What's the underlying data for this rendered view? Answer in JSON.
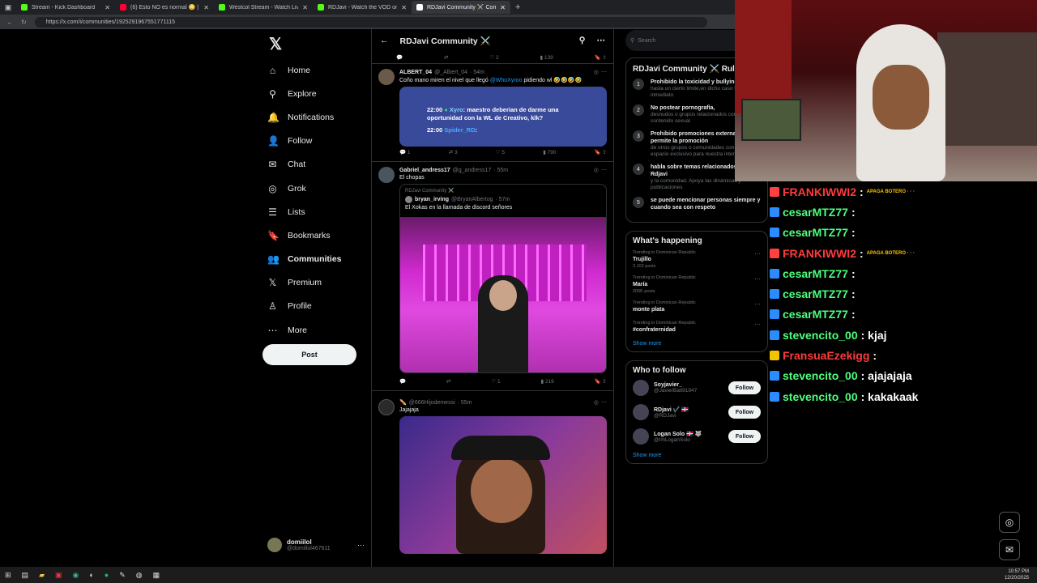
{
  "tabs": [
    {
      "label": "Stream - Kick Dashboard",
      "color": "#53fc18",
      "active": false
    },
    {
      "label": "(6) Esto NO es normal 😳 | La Kick",
      "color": "#ff0033",
      "active": false
    },
    {
      "label": "Westcol Stream - Watch Live on Kick",
      "color": "#53fc18",
      "active": false
    },
    {
      "label": "RDJavi - Watch the VOD on Kick",
      "color": "#53fc18",
      "active": false
    },
    {
      "label": "RDJavi Community ⚔️ Community",
      "color": "#ffffff",
      "active": true
    }
  ],
  "address": {
    "url": "https://x.com/i/communities/1925291967551771115"
  },
  "nav": {
    "logo": "𝕏",
    "items": [
      {
        "icon": "⌂",
        "label": "Home",
        "bold": false
      },
      {
        "icon": "⚲",
        "label": "Explore",
        "bold": false
      },
      {
        "icon": "🔔",
        "label": "Notifications",
        "bold": false
      },
      {
        "icon": "👤",
        "label": "Follow",
        "bold": false
      },
      {
        "icon": "✉",
        "label": "Chat",
        "bold": false
      },
      {
        "icon": "◎",
        "label": "Grok",
        "bold": false
      },
      {
        "icon": "☰",
        "label": "Lists",
        "bold": false
      },
      {
        "icon": "🔖",
        "label": "Bookmarks",
        "bold": false
      },
      {
        "icon": "👥",
        "label": "Communities",
        "bold": true
      },
      {
        "icon": "𝕏",
        "label": "Premium",
        "bold": false
      },
      {
        "icon": "♙",
        "label": "Profile",
        "bold": false
      },
      {
        "icon": "⋯",
        "label": "More",
        "bold": false
      }
    ],
    "post": "Post"
  },
  "account": {
    "name": "domiilol",
    "handle": "@domiilol467611"
  },
  "feed": {
    "title": "RDJavi Community ⚔️",
    "top_actions": {
      "replies": "",
      "retweets": "",
      "likes": "2",
      "views": "139"
    },
    "tweets": [
      {
        "name": "ALBERT_04",
        "handle": "@_Albert_04",
        "time": "· 54m",
        "text": "Coño mano miren el nivel que llegó",
        "mention": "@WhoXyroo",
        "text2": "pidiendo wl 🤣🤣🤣🤣",
        "chat_lines": [
          {
            "time": "22:00",
            "user": "Xyro",
            "msg": "maestro deberian de darme una oportunidad con la WL de Creativo, klk?"
          },
          {
            "time": "22:00",
            "user": "Spider_RD",
            "msg": ""
          }
        ],
        "replies": "1",
        "retweets": "3",
        "likes": "5",
        "views": "790"
      },
      {
        "name": "Gabriel_andress17",
        "handle": "@g_andress17",
        "time": "· 55m",
        "text": "El chopas",
        "quote_community": "RDJavi Community ⚔️",
        "quote_name": "bryan_irving",
        "quote_handle": "@BryanAlbertog",
        "quote_time": "· 57m",
        "quote_text": "El Xokas en la llamada de discord señores",
        "replies": "",
        "retweets": "",
        "likes": "1",
        "views": "219"
      },
      {
        "name": "✏️",
        "handle": "@666Hijodemessi",
        "time": "· 55m",
        "text": "Jajajaja"
      }
    ]
  },
  "right": {
    "search_placeholder": "Search",
    "rules_title": "RDJavi Community ⚔️ Rules",
    "rules": [
      {
        "n": "1",
        "title": "Prohibido la toxicidad y bullying",
        "desc": "hasta un cierto limite,en dicho caso bloqueo inmediato"
      },
      {
        "n": "2",
        "title": "No postear pornografía,",
        "desc": "desnudos o grupos relacionados con contenido sexual"
      },
      {
        "n": "3",
        "title": "Prohibido promociones externas, permite la promoción",
        "desc": "de otros grupos o comunidades con un espacio exclusivo para nuestra interacción"
      },
      {
        "n": "4",
        "title": "habla sobre temas relacionados con Rdjavi",
        "desc": "y la comunidad. Apoya las dinámicas y publicaciones"
      },
      {
        "n": "5",
        "title": "se puede mencionar personas siempre y cuando sea con respeto",
        "desc": ""
      }
    ],
    "happening_title": "What's happening",
    "trends": [
      {
        "meta": "Trending in Dominican Republic",
        "name": "Trujillo",
        "posts": "2,102 posts"
      },
      {
        "meta": "Trending in Dominican Republic",
        "name": "María",
        "posts": "206K posts"
      },
      {
        "meta": "Trending in Dominican Republic",
        "name": "monte plata",
        "posts": ""
      },
      {
        "meta": "Trending in Dominican Republic",
        "name": "#confraternidad",
        "posts": ""
      }
    ],
    "show_more": "Show more",
    "wtf_title": "Who to follow",
    "wtf": [
      {
        "name": "Soyjavier_",
        "handle": "@JavierBati91947",
        "btn": "Follow"
      },
      {
        "name": "RDjavi ✔️ 🇩🇴",
        "handle": "@RDJavi",
        "btn": "Follow"
      },
      {
        "name": "Logan Solo 🇩🇴 🐺",
        "handle": "@ImLoganSolo",
        "btn": "Follow"
      }
    ],
    "show_more2": "Show more"
  },
  "chat": [
    {
      "user": "FRANKIWWI2",
      "text": ":",
      "color": "#ff3b3b",
      "badge": "#ff4040",
      "emotes": "APAGA BOTERO · · ·"
    },
    {
      "user": "cesarMTZ77",
      "text": ":",
      "color": "#4dff7c",
      "badge": "#2a8cff",
      "emotes": ""
    },
    {
      "user": "cesarMTZ77",
      "text": ":",
      "color": "#4dff7c",
      "badge": "#2a8cff",
      "emotes": ""
    },
    {
      "user": "FRANKIWWI2",
      "text": ":",
      "color": "#ff3b3b",
      "badge": "#ff4040",
      "emotes": "APAGA BOTERO · · ·"
    },
    {
      "user": "cesarMTZ77",
      "text": ":",
      "color": "#4dff7c",
      "badge": "#2a8cff",
      "emotes": ""
    },
    {
      "user": "cesarMTZ77",
      "text": ":",
      "color": "#4dff7c",
      "badge": "#2a8cff",
      "emotes": ""
    },
    {
      "user": "cesarMTZ77",
      "text": ":",
      "color": "#4dff7c",
      "badge": "#2a8cff",
      "emotes": ""
    },
    {
      "user": "stevencito_00",
      "text": ": kjaj",
      "color": "#4dff7c",
      "badge": "#2a8cff",
      "emotes": ""
    },
    {
      "user": "FransuaEzekigg",
      "text": ":",
      "color": "#ff3b3b",
      "badge": "#f5c400",
      "emotes": ""
    },
    {
      "user": "stevencito_00",
      "text": ": ajajajaja",
      "color": "#4dff7c",
      "badge": "#2a8cff",
      "emotes": ""
    },
    {
      "user": "stevencito_00",
      "text": ": kakakaak",
      "color": "#4dff7c",
      "badge": "#2a8cff",
      "emotes": ""
    }
  ],
  "clock": {
    "time": "10:57 PM",
    "date": "12/20/2025"
  }
}
